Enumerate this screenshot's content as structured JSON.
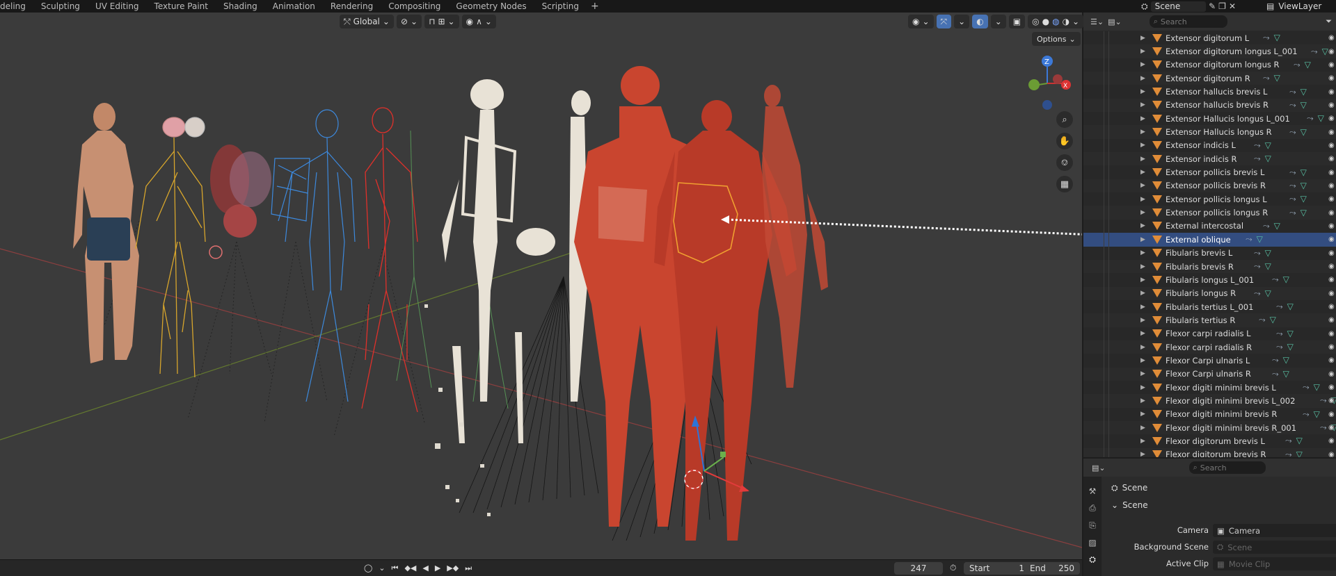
{
  "topbar": {
    "tabs": [
      "deling",
      "Sculpting",
      "UV Editing",
      "Texture Paint",
      "Shading",
      "Animation",
      "Rendering",
      "Compositing",
      "Geometry Nodes",
      "Scripting"
    ],
    "add_label": "+",
    "scene": "Scene",
    "view_layer": "ViewLayer"
  },
  "viewport": {
    "orientation": "Global",
    "options_label": "Options",
    "gizmo": {
      "z": "Z",
      "x": "X"
    }
  },
  "timeline": {
    "current_frame": "247",
    "start_label": "Start",
    "start": "1",
    "end_label": "End",
    "end": "250"
  },
  "outliner": {
    "search_placeholder": "Search",
    "items": [
      {
        "name": "Extensor digitorum L",
        "sel": false
      },
      {
        "name": "Extensor digitorum longus L_001",
        "sel": false
      },
      {
        "name": "Extensor digitorum longus R",
        "sel": false
      },
      {
        "name": "Extensor digitorum R",
        "sel": false
      },
      {
        "name": "Extensor hallucis brevis L",
        "sel": false
      },
      {
        "name": "Extensor hallucis brevis R",
        "sel": false
      },
      {
        "name": "Extensor Hallucis longus L_001",
        "sel": false
      },
      {
        "name": "Extensor Hallucis longus R",
        "sel": false
      },
      {
        "name": "Extensor indicis L",
        "sel": false
      },
      {
        "name": "Extensor indicis R",
        "sel": false
      },
      {
        "name": "Extensor pollicis brevis L",
        "sel": false
      },
      {
        "name": "Extensor pollicis brevis R",
        "sel": false
      },
      {
        "name": "Extensor pollicis longus L",
        "sel": false
      },
      {
        "name": "Extensor pollicis longus R",
        "sel": false
      },
      {
        "name": "External intercostal",
        "sel": false
      },
      {
        "name": "External oblique",
        "sel": true
      },
      {
        "name": "Fibularis brevis L",
        "sel": false
      },
      {
        "name": "Fibularis brevis R",
        "sel": false
      },
      {
        "name": "Fibularis longus L_001",
        "sel": false
      },
      {
        "name": "Fibularis longus R",
        "sel": false
      },
      {
        "name": "Fibularis tertius L_001",
        "sel": false
      },
      {
        "name": "Fibularis tertius R",
        "sel": false
      },
      {
        "name": "Flexor carpi radialis L",
        "sel": false
      },
      {
        "name": "Flexor carpi radialis R",
        "sel": false
      },
      {
        "name": "Flexor Carpi ulnaris L",
        "sel": false
      },
      {
        "name": "Flexor Carpi ulnaris R",
        "sel": false
      },
      {
        "name": "Flexor digiti minimi brevis L",
        "sel": false
      },
      {
        "name": "Flexor digiti minimi brevis L_002",
        "sel": false
      },
      {
        "name": "Flexor digiti minimi brevis R",
        "sel": false
      },
      {
        "name": "Flexor digiti minimi brevis R_001",
        "sel": false
      },
      {
        "name": "Flexor digitorum brevis L",
        "sel": false
      },
      {
        "name": "Flexor digitorum brevis R",
        "sel": false
      }
    ]
  },
  "properties": {
    "search_placeholder": "Search",
    "context": "Scene",
    "panel_title": "Scene",
    "camera_label": "Camera",
    "camera_value": "Camera",
    "bg_label": "Background Scene",
    "bg_placeholder": "Scene",
    "clip_label": "Active Clip",
    "clip_placeholder": "Movie Clip"
  },
  "colors": {
    "accent": "#4772b3",
    "selection": "#334d80",
    "mesh_icon": "#e08c38",
    "muscle": "#c9452f",
    "nerve": "#d8a62c",
    "vessel": "#3d8ee6",
    "artery": "#e0302a",
    "bone": "#e8e2d6"
  }
}
